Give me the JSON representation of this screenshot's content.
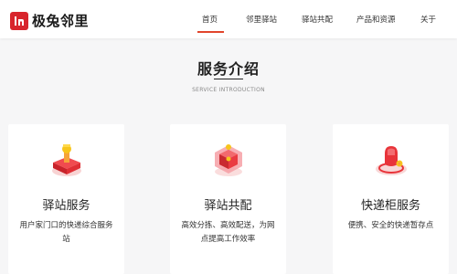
{
  "header": {
    "logo_text": "极兔邻里",
    "logo_mark_text": "In",
    "nav": [
      {
        "label": "首页"
      },
      {
        "label": "邻里驿站"
      },
      {
        "label": "驿站共配"
      },
      {
        "label": "产品和资源"
      },
      {
        "label": "关于"
      }
    ]
  },
  "section": {
    "title": "服务介绍",
    "subtitle": "SERVICE INTRODUCTION"
  },
  "cards": [
    {
      "title": "驿站服务",
      "desc": "用户家门口的快递综合服务站",
      "icon": "station-service-icon"
    },
    {
      "title": "驿站共配",
      "desc": "高效分拣、高效配送，为网点提高工作效率",
      "icon": "shared-delivery-icon"
    },
    {
      "title": "快递柜服务",
      "desc": "便携、安全的快递暂存点",
      "icon": "parcel-locker-icon"
    }
  ],
  "colors": {
    "brand_red": "#d8242c",
    "accent_underline": "#e1452b",
    "icon_red": "#e8343a",
    "icon_yellow": "#f7c51c",
    "background": "#f6f6f7"
  }
}
